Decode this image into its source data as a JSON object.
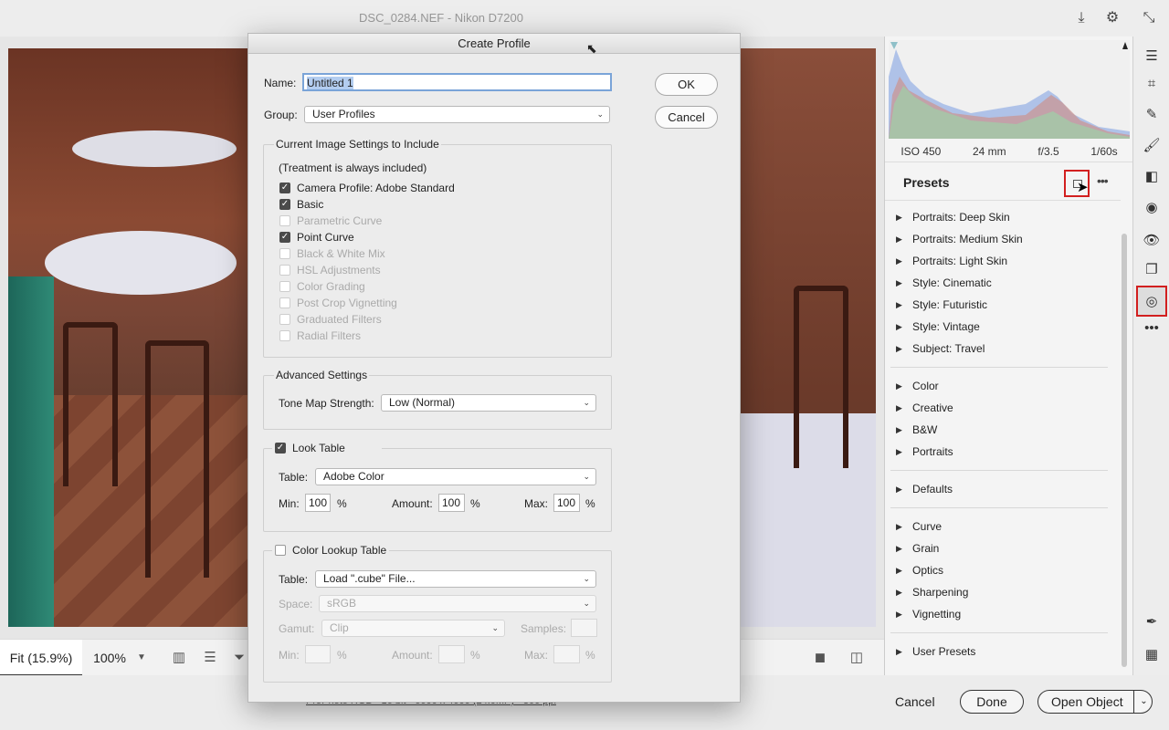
{
  "window": {
    "title": "DSC_0284.NEF  -  Nikon D7200"
  },
  "bottom_bar": {
    "fit": "Fit (15.9%)",
    "zoom": "100%"
  },
  "footer": {
    "info": "ProPhoto RGB - 16 bit - 6000 x 4000 (24.0MP) - 300 ppi",
    "cancel": "Cancel",
    "done": "Done",
    "open": "Open Object"
  },
  "exif": {
    "iso": "ISO 450",
    "focal": "24 mm",
    "aperture": "f/3.5",
    "shutter": "1/60s"
  },
  "presets": {
    "title": "Presets",
    "group1": [
      "Portraits: Deep Skin",
      "Portraits: Medium Skin",
      "Portraits: Light Skin",
      "Style: Cinematic",
      "Style: Futuristic",
      "Style: Vintage",
      "Subject: Travel"
    ],
    "group2": [
      "Color",
      "Creative",
      "B&W",
      "Portraits"
    ],
    "group3": [
      "Defaults"
    ],
    "group4": [
      "Curve",
      "Grain",
      "Optics",
      "Sharpening",
      "Vignetting"
    ],
    "group5": [
      "User Presets"
    ]
  },
  "dialog": {
    "title": "Create Profile",
    "name_label": "Name:",
    "name_value": "Untitled 1",
    "group_label": "Group:",
    "group_value": "User Profiles",
    "ok": "OK",
    "cancel": "Cancel",
    "settings_title": "Current Image Settings to Include",
    "treatment_note": "(Treatment is always included)",
    "settings": [
      {
        "label": "Camera Profile: Adobe Standard",
        "checked": true
      },
      {
        "label": "Basic",
        "checked": true
      },
      {
        "label": "Parametric Curve",
        "checked": false
      },
      {
        "label": "Point Curve",
        "checked": true
      },
      {
        "label": "Black & White Mix",
        "checked": false
      },
      {
        "label": "HSL Adjustments",
        "checked": false
      },
      {
        "label": "Color Grading",
        "checked": false
      },
      {
        "label": "Post Crop Vignetting",
        "checked": false
      },
      {
        "label": "Graduated Filters",
        "checked": false
      },
      {
        "label": "Radial Filters",
        "checked": false
      }
    ],
    "advanced_title": "Advanced Settings",
    "tone_map_label": "Tone Map Strength:",
    "tone_map_value": "Low (Normal)",
    "look_table": {
      "title": "Look Table",
      "checked": true,
      "table_label": "Table:",
      "table_value": "Adobe Color",
      "min_label": "Min:",
      "min_value": "100",
      "amount_label": "Amount:",
      "amount_value": "100",
      "max_label": "Max:",
      "max_value": "100",
      "percent": "%"
    },
    "color_lookup": {
      "title": "Color Lookup Table",
      "checked": false,
      "table_label": "Table:",
      "table_value": "Load \".cube\" File...",
      "space_label": "Space:",
      "space_value": "sRGB",
      "gamut_label": "Gamut:",
      "gamut_value": "Clip",
      "samples_label": "Samples:",
      "min_label": "Min:",
      "amount_label": "Amount:",
      "max_label": "Max:",
      "percent": "%"
    }
  },
  "colors": {
    "highlight_red": "#d21f1f",
    "selection_blue": "#b3cdf0"
  }
}
